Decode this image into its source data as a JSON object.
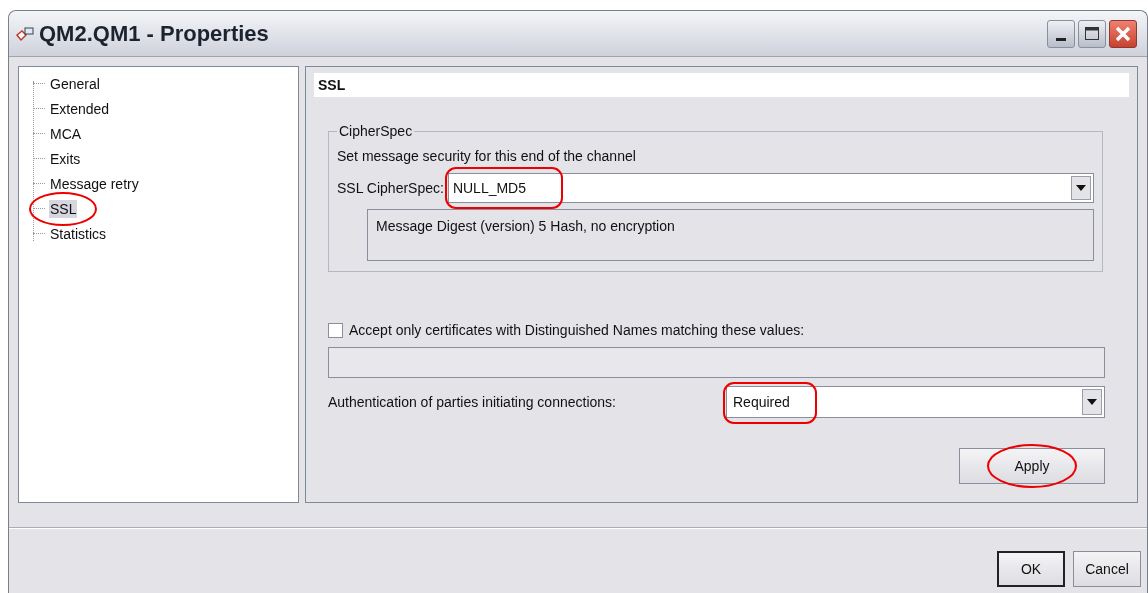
{
  "window": {
    "title": "QM2.QM1 - Properties"
  },
  "tree": {
    "items": [
      {
        "label": "General",
        "selected": false,
        "circled": false
      },
      {
        "label": "Extended",
        "selected": false,
        "circled": false
      },
      {
        "label": "MCA",
        "selected": false,
        "circled": false
      },
      {
        "label": "Exits",
        "selected": false,
        "circled": false
      },
      {
        "label": "Message retry",
        "selected": false,
        "circled": false
      },
      {
        "label": "SSL",
        "selected": true,
        "circled": true
      },
      {
        "label": "Statistics",
        "selected": false,
        "circled": false
      }
    ]
  },
  "page": {
    "heading": "SSL",
    "cipherspec_group": {
      "legend": "CipherSpec",
      "description": "Set message security for this end of the channel",
      "label": "SSL CipherSpec:",
      "value": "NULL_MD5",
      "circled": true,
      "detail": "Message Digest (version) 5 Hash, no encryption"
    },
    "accept_certificates": {
      "label": "Accept only certificates with Distinguished Names matching these values:",
      "checked": false
    },
    "authentication": {
      "label": "Authentication of parties initiating connections:",
      "value": "Required",
      "circled": true
    },
    "apply_button": {
      "label": "Apply",
      "circled": true
    }
  },
  "buttons": [
    {
      "label": "OK",
      "default": true
    },
    {
      "label": "Cancel",
      "default": false
    }
  ]
}
